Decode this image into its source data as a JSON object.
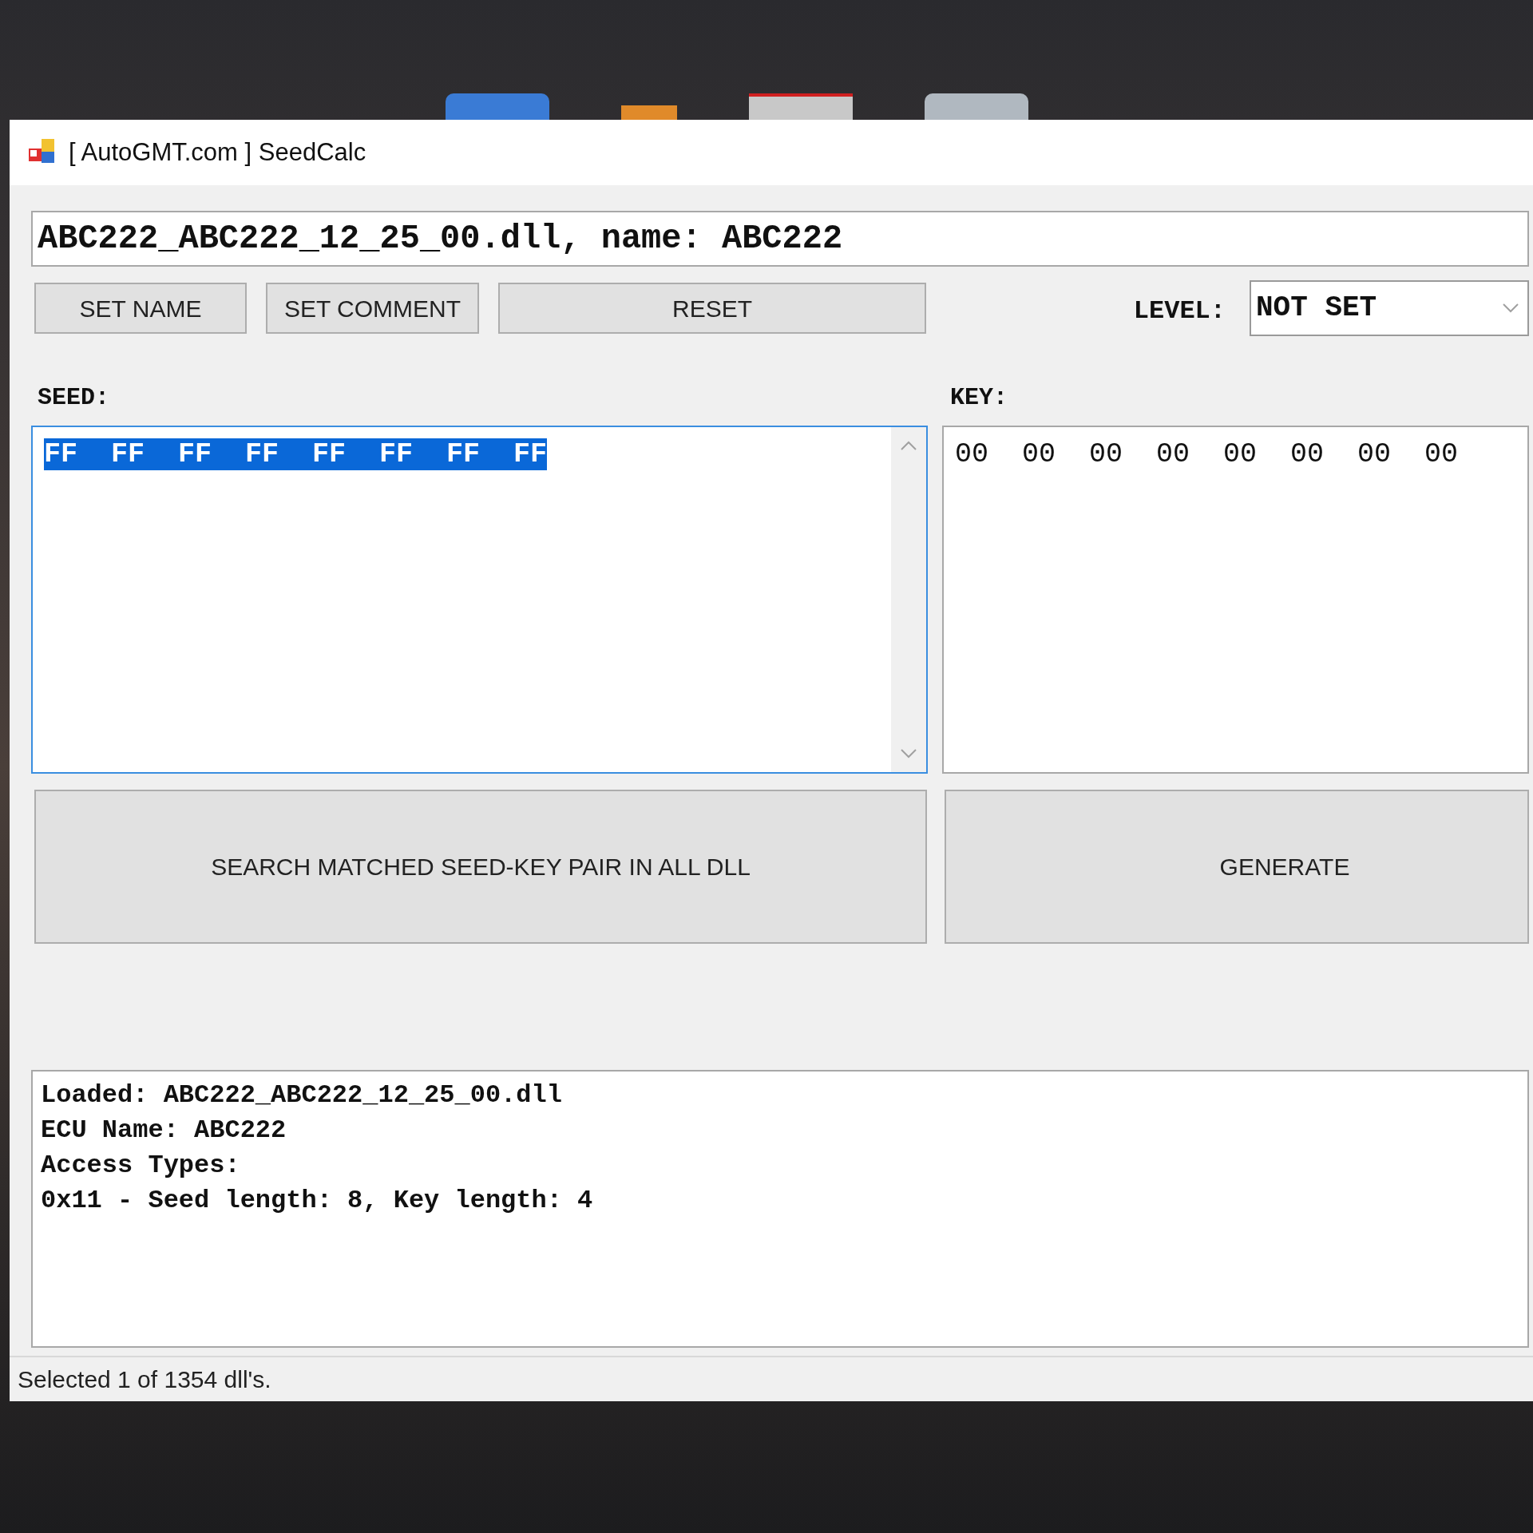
{
  "window": {
    "title": "[ AutoGMT.com ] SeedCalc"
  },
  "file_field": {
    "value": "ABC222_ABC222_12_25_00.dll, name: ABC222"
  },
  "buttons": [
    {
      "label": "SET NAME"
    },
    {
      "label": "SET COMMENT"
    },
    {
      "label": "RESET"
    }
  ],
  "level": {
    "label": "LEVEL:",
    "value": "NOT SET"
  },
  "seed": {
    "label": "SEED:",
    "value": "FF  FF  FF  FF  FF  FF  FF  FF",
    "selected": true
  },
  "key": {
    "label": "KEY:",
    "value": "00  00  00  00  00  00  00  00"
  },
  "actions": [
    {
      "label": "SEARCH MATCHED SEED-KEY PAIR IN ALL DLL"
    },
    {
      "label": "GENERATE"
    }
  ],
  "log": [
    "Loaded: ABC222_ABC222_12_25_00.dll",
    "ECU Name: ABC222",
    "Access Types:",
    "0x11 - Seed length: 8, Key length: 4"
  ],
  "status_bar": {
    "text": "Selected 1 of 1354 dll's."
  }
}
